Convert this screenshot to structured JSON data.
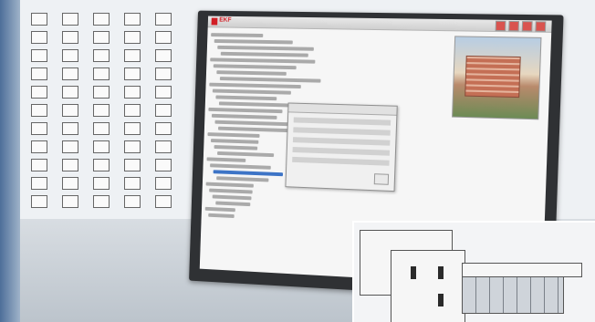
{
  "screen": {
    "logo_text": "EKF",
    "window_title": "",
    "dialog_title": ""
  },
  "icons": {
    "logo": "ekf-logo-icon",
    "toolbar": "toolbar-icons"
  }
}
